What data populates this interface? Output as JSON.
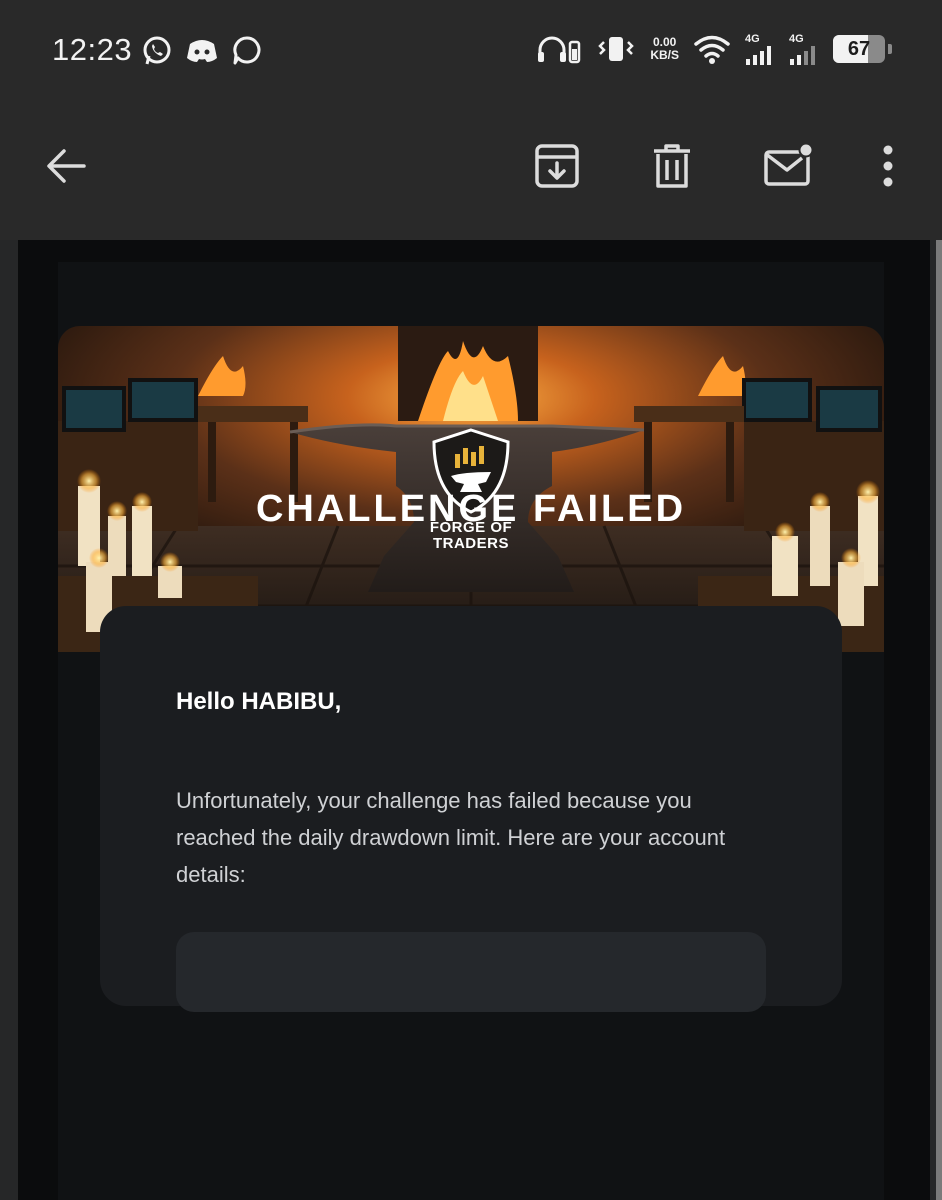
{
  "status_bar": {
    "time": "12:23",
    "net_speed_value": "0.00",
    "net_speed_unit": "KB/S",
    "signal_1": "4G",
    "signal_2": "4G",
    "battery": "67",
    "battery_level_percent": 67,
    "left_icons": [
      "whatsapp-icon",
      "discord-icon",
      "message-bubble-icon"
    ],
    "right_icons": [
      "headphones-battery-icon",
      "vibrate-icon",
      "wifi-icon"
    ]
  },
  "app_bar": {
    "actions": [
      "back-arrow-icon",
      "archive-icon",
      "delete-icon",
      "mark-unread-icon",
      "more-vert-icon"
    ]
  },
  "email": {
    "banner_brand_line1": "FORGE OF",
    "banner_brand_line2": "TRADERS",
    "headline": "CHALLENGE FAILED",
    "greeting": "Hello HABIBU,",
    "body": "Unfortunately, your challenge has failed because you reached the daily drawdown limit. Here are your account details:"
  },
  "colors": {
    "app_bar": "#292929",
    "mail_background": "#101214",
    "content_box": "#1b1d20",
    "accent_gold": "#e8b33a"
  }
}
